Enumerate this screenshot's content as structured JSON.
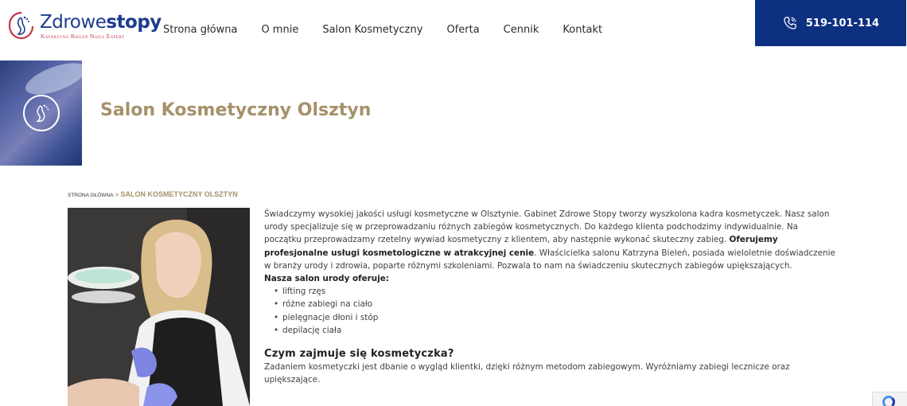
{
  "logo": {
    "word_part1": "Zdrowe",
    "word_part2": "stopy",
    "tagline": "Katarzyna Bieleń Nails Expert"
  },
  "nav": {
    "items": [
      {
        "label": "Strona główna"
      },
      {
        "label": "O mnie"
      },
      {
        "label": "Salon Kosmetyczny"
      },
      {
        "label": "Oferta"
      },
      {
        "label": "Cennik"
      },
      {
        "label": "Kontakt"
      }
    ]
  },
  "phone": {
    "number": "519-101-114"
  },
  "hero": {
    "title": "Salon Kosmetyczny Olsztyn"
  },
  "breadcrumb": {
    "home": "Strona główna",
    "separator": "»",
    "current": "Salon Kosmetyczny Olsztyn"
  },
  "content": {
    "intro_part1": "Świadczymy wysokiej jakości usługi kosmetyczne w Olsztynie. Gabinet Zdrowe Stopy tworzy wyszkolona kadra kosmetyczek. Nasz salon urody specjalizuje się w przeprowadzaniu różnych zabiegów kosmetycznych. Do każdego klienta podchodzimy indywidualnie. Na początku przeprowadzamy rzetelny wywiad kosmetyczny z klientem, aby następnie wykonać skuteczny zabieg. ",
    "intro_bold": "Oferujemy profesjonalne usługi kosmetologiczne w atrakcyjnej cenie",
    "intro_part2": ". Właścicielka salonu Katrzyna Bieleń, posiada wieloletnie doświadczenie w branży urody i zdrowia, poparte różnymi szkoleniami. Pozwala to nam na świadczeniu skutecznych zabiegów upiększających.",
    "offer_heading": "Nasza salon urody oferuje:",
    "offer_items": [
      {
        "label": "lifting rzęs"
      },
      {
        "label": "różne zabiegi na ciało"
      },
      {
        "label": "pielęgnacje dłoni i stóp"
      },
      {
        "label": "depilację ciała"
      }
    ],
    "section_heading": "Czym zajmuje się kosmetyczka?",
    "section_text": "Zadaniem kosmetyczki jest dbanie o wygląd klientki, dzięki różnym metodom zabiegowym. Wyróżniamy zabiegi lecznicze oraz upiększające."
  },
  "colors": {
    "brand_navy": "#0d3080",
    "accent_gold": "#a5916a",
    "logo_red": "#c7364d"
  }
}
